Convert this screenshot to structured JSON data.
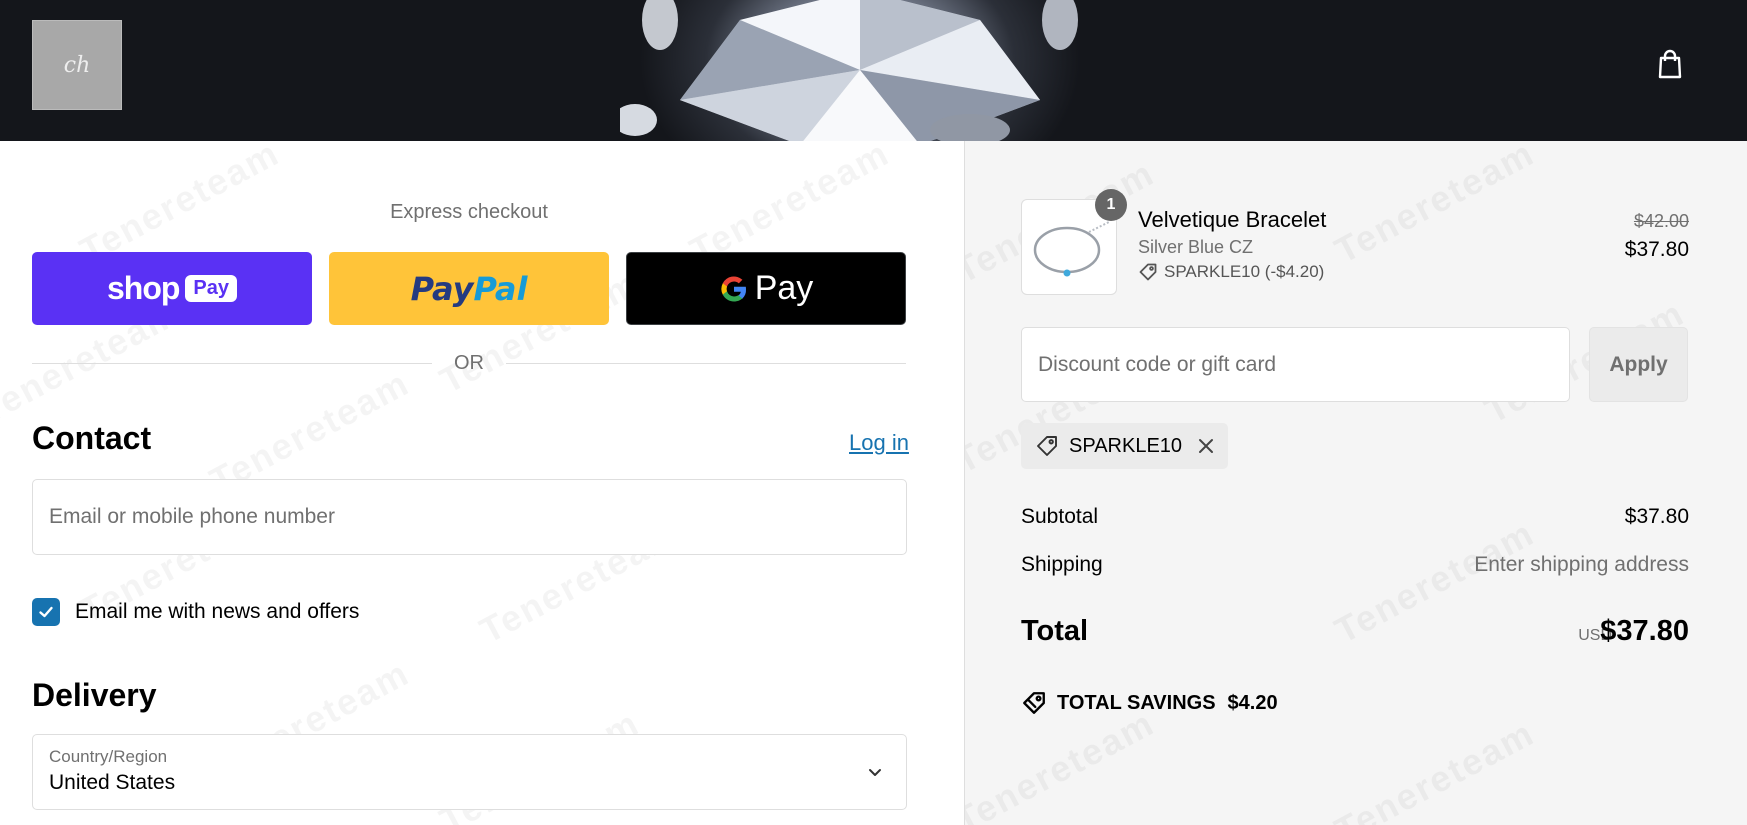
{
  "header": {
    "logo_text": "ch",
    "cart_icon": "shopping-bag-icon"
  },
  "watermark": {
    "text": "Tenereteam"
  },
  "express": {
    "label": "Express checkout",
    "shop_pay": {
      "brand": "shop",
      "chip": "Pay",
      "color": "#5a31f4"
    },
    "paypal": {
      "part1": "Pay",
      "part2": "Pal",
      "color": "#ffc439"
    },
    "gpay": {
      "text": "Pay",
      "color": "#000000"
    },
    "or_label": "OR"
  },
  "contact": {
    "heading": "Contact",
    "login_link": "Log in",
    "email_placeholder": "Email or mobile phone number",
    "newsletter_label": "Email me with news and offers",
    "newsletter_checked": true
  },
  "delivery": {
    "heading": "Delivery",
    "country_label": "Country/Region",
    "country_value": "United States"
  },
  "summary": {
    "product": {
      "quantity": "1",
      "name": "Velvetique Bracelet",
      "variant": "Silver Blue CZ",
      "discount": "SPARKLE10 (-$4.20)",
      "price_original": "$42.00",
      "price": "$37.80"
    },
    "discount_placeholder": "Discount code or gift card",
    "apply_label": "Apply",
    "applied_code": "SPARKLE10",
    "subtotal_label": "Subtotal",
    "subtotal_value": "$37.80",
    "shipping_label": "Shipping",
    "shipping_value": "Enter shipping address",
    "total_label": "Total",
    "total_currency": "USD",
    "total_value": "$37.80",
    "savings_label": "TOTAL SAVINGS",
    "savings_value": "$4.20"
  },
  "colors": {
    "accent": "#1773b0",
    "summary_bg": "#f5f5f5"
  }
}
